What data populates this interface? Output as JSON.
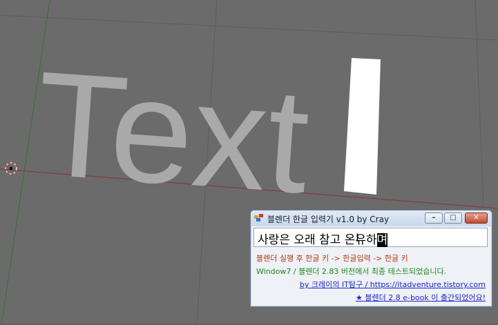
{
  "viewport": {
    "text_object": "Text",
    "colors": {
      "background": "#6b6b6b",
      "grid": "#5e5e5e",
      "x_axis": "#8b2a2a",
      "y_axis": "#2f6b2f",
      "text_fill": "#a9a9a9",
      "cursor_block": "#ffffff"
    }
  },
  "window": {
    "title": "블렌더 한글 입력기 v1.0 by Cray",
    "minimize_icon": "minimize-icon",
    "maximize_icon": "maximize-icon",
    "close_icon": "close-icon",
    "input": {
      "value": "사랑은 오래 참고 온유하",
      "composing": "며"
    },
    "instructions": "블렌더 실행 후 한글 키 -> 한글입력 -> 한글 키",
    "tested": "Window7 / 블렌더 2.83 버전에서 최종 테스트되었습니다.",
    "blog_link": "by 크레이의 IT탐구 / https://itadventure.tistory.com",
    "book_link": "★ 블렌더 2.8 e-book 이 출간되었어요!",
    "colors": {
      "instructions": "#b23a12",
      "tested": "#1f8a18",
      "links": "#1a26c7"
    }
  }
}
